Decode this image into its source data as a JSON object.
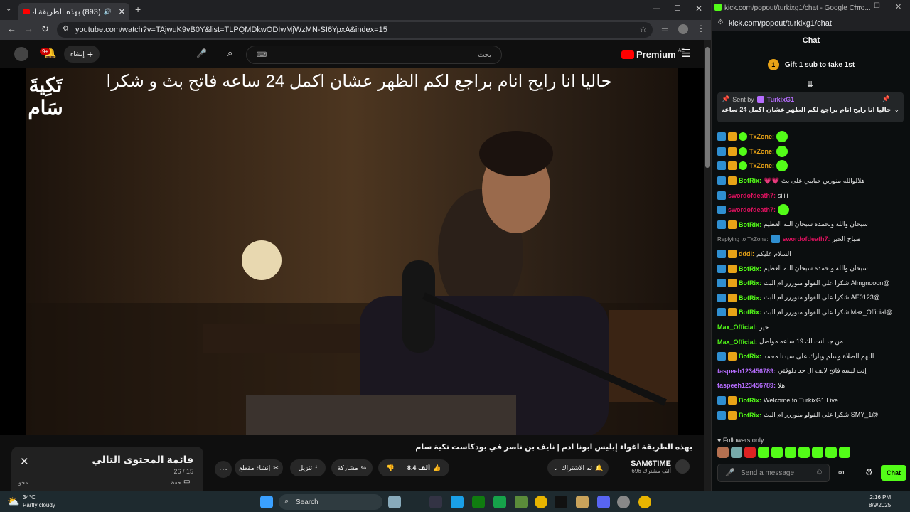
{
  "left_window": {
    "tab_title": "(893) بهذه الطريقة اغواء إبليس",
    "url": "youtube.com/watch?v=TAjwuK9vB0Y&list=TLPQMDkwODIwMjWzMN-SI6YpxA&index=15",
    "header": {
      "notifications_badge": "9+",
      "create_label": "إنشاء",
      "search_placeholder": "بحث",
      "premium_label": "Premium",
      "premium_region": "AE"
    },
    "video": {
      "logo_text_line1": "تَكِيةَ",
      "logo_text_line2": "سَام",
      "caption": "حاليا انا رايح انام براجع لكم الظهر عشان اكمل 24 ساعه فاتح بث و شكرا"
    },
    "below": {
      "video_title": "بهذه الطريقة اغواء إبليس ابونا ادم | نايف بن ناصر في بودكاست تكية سام",
      "playlist_title": "قائمة المحتوى التالي",
      "playlist_progress": "26 / 15",
      "playlist_save": "حفظ",
      "playlist_author": "محو",
      "channel_name": "SAM6TIME",
      "subscribers": "696 ألف مشترك",
      "subscribed_label": "تم الاشتراك",
      "likes": "8.4 ألف",
      "share_label": "مشاركة",
      "download_label": "تنزيل",
      "clip_label": "إنشاء مقطع"
    }
  },
  "right_window": {
    "title": "kick.com/popout/turkixg1/chat - Google Chro...",
    "address": "kick.com/popout/turkixg1/chat",
    "chat_header": "Chat",
    "gift_label": "Gift 1 sub to take 1st",
    "pinned": {
      "sent_by_label": "Sent by",
      "sender": "TurkixG1",
      "text": "حاليا انا رايح انام براجع لكم الظهر عشان اكمل 24 ساعه فاتح بث و شكرا"
    },
    "messages": [
      {
        "user": "TxZone:",
        "text": "",
        "color": "#e8a317",
        "badges": 3,
        "emote": true
      },
      {
        "user": "TxZone:",
        "text": "",
        "color": "#e8a317",
        "badges": 3,
        "emote": true
      },
      {
        "user": "TxZone:",
        "text": "",
        "color": "#e8a317",
        "badges": 3,
        "emote": true
      },
      {
        "user": "BotRix:",
        "text": "هلالوالله منورين حبايبي على بث 💗💗",
        "color": "#53fc18",
        "badges": 2,
        "emote": false
      },
      {
        "user": "swordofdeath7:",
        "text": "siiiii",
        "color": "#e0115f",
        "badges": 1,
        "emote": false
      },
      {
        "user": "swordofdeath7:",
        "text": "",
        "color": "#e0115f",
        "badges": 1,
        "emote": true
      },
      {
        "user": "BotRix:",
        "text": "سبحان والله وبحمده سبحان الله العظيم",
        "color": "#53fc18",
        "badges": 2,
        "emote": false
      },
      {
        "user": "swordofdeath7:",
        "text": "صباح الخير",
        "color": "#e0115f",
        "badges": 1,
        "emote": false,
        "reply": "Replying to TxZone:"
      },
      {
        "user": "dddl:",
        "text": "السلام عليكم",
        "color": "#e8a317",
        "badges": 2,
        "emote": false
      },
      {
        "user": "BotRix:",
        "text": "سبحان والله وبحمده سبحان الله العظيم",
        "color": "#53fc18",
        "badges": 2,
        "emote": false
      },
      {
        "user": "BotRix:",
        "text": "@Almgnooon شكرا على الفولو منوررر ام البث",
        "color": "#53fc18",
        "badges": 2,
        "emote": false
      },
      {
        "user": "BotRix:",
        "text": "@AE0123 شكرا على الفولو منوررر ام البث",
        "color": "#53fc18",
        "badges": 2,
        "emote": false
      },
      {
        "user": "BotRix:",
        "text": "@Max_Official شكرا على الفولو منوررر ام البث",
        "color": "#53fc18",
        "badges": 2,
        "emote": false
      },
      {
        "user": "Max_Official:",
        "text": "خير",
        "color": "#53fc18",
        "badges": 0,
        "emote": false
      },
      {
        "user": "Max_Official:",
        "text": "من جد انت لك 19 ساعه مواصل",
        "color": "#53fc18",
        "badges": 0,
        "emote": false
      },
      {
        "user": "BotRix:",
        "text": "اللهم الصلاة وسلم وبارك على سيدنا محمد",
        "color": "#53fc18",
        "badges": 2,
        "emote": false
      },
      {
        "user": "taspeeh123456789:",
        "text": "إنت ليسه فاتح لايف ال حد دلوقتي",
        "color": "#b66dff",
        "badges": 0,
        "emote": false
      },
      {
        "user": "taspeeh123456789:",
        "text": "هلا",
        "color": "#b66dff",
        "badges": 0,
        "emote": false
      },
      {
        "user": "BotRix:",
        "text": "Welcome to TurkixG1 Live",
        "color": "#53fc18",
        "badges": 2,
        "emote": false
      },
      {
        "user": "BotRix:",
        "text": "@SMY_1 شكرا على الفولو منوررر ام البث",
        "color": "#53fc18",
        "badges": 2,
        "emote": false
      }
    ],
    "followers_only": "Followers only",
    "send_placeholder": "Send a message",
    "chat_button": "Chat"
  },
  "taskbar": {
    "weather_temp": "34°C",
    "weather_desc": "Partly cloudy",
    "search_label": "Search",
    "time": "2:16 PM",
    "date": "8/9/2025"
  }
}
